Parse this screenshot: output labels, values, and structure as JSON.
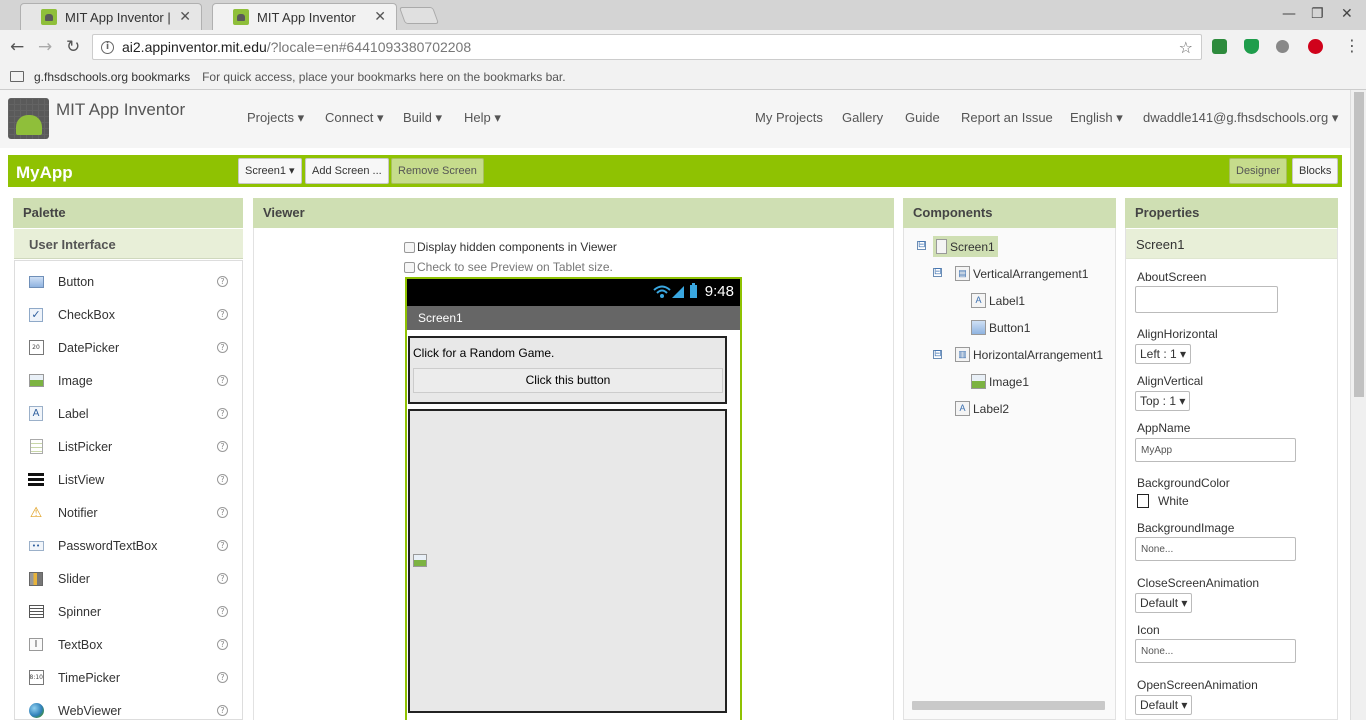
{
  "browser": {
    "tabs": [
      {
        "title": "MIT App Inventor | Explo",
        "active": false
      },
      {
        "title": "MIT App Inventor",
        "active": true
      }
    ],
    "url_host": "ai2.appinventor.mit.edu",
    "url_rest": "/?locale=en#6441093380702208",
    "bookmarks": {
      "folder": "g.fhsdschools.org bookmarks",
      "hint": "For quick access, place your bookmarks here on the bookmarks bar."
    },
    "extensions": [
      "google-drive-icon",
      "shield-icon",
      "audio-icon",
      "adblock-icon"
    ]
  },
  "app": {
    "title": "MIT App Inventor",
    "nav_left": [
      "Projects ▾",
      "Connect ▾",
      "Build ▾",
      "Help ▾"
    ],
    "nav_right": [
      "My Projects",
      "Gallery",
      "Guide",
      "Report an Issue",
      "English ▾",
      "dwaddle141@g.fhsdschools.org ▾"
    ]
  },
  "project": {
    "name": "MyApp",
    "screen_select": "Screen1 ▾",
    "add_screen": "Add Screen ...",
    "remove_screen": "Remove Screen",
    "designer": "Designer",
    "blocks": "Blocks"
  },
  "palette": {
    "header": "Palette",
    "category": "User Interface",
    "items": [
      "Button",
      "CheckBox",
      "DatePicker",
      "Image",
      "Label",
      "ListPicker",
      "ListView",
      "Notifier",
      "PasswordTextBox",
      "Slider",
      "Spinner",
      "TextBox",
      "TimePicker",
      "WebViewer"
    ],
    "help_glyph": "?"
  },
  "viewer": {
    "header": "Viewer",
    "hidden_option": "Display hidden components in Viewer",
    "tablet_option": "Check to see Preview on Tablet size.",
    "time": "9:48",
    "screen_title": "Screen1",
    "label1_text": "Click for a Random Game.",
    "button1_text": "Click this button"
  },
  "components": {
    "header": "Components",
    "tree": [
      {
        "name": "Screen1",
        "icon": "screen-icon",
        "depth": 0,
        "expandable": true,
        "selected": true
      },
      {
        "name": "VerticalArrangement1",
        "icon": "vertical-arrangement-icon",
        "depth": 1,
        "expandable": true
      },
      {
        "name": "Label1",
        "icon": "label-icon",
        "depth": 2
      },
      {
        "name": "Button1",
        "icon": "button-icon",
        "depth": 2
      },
      {
        "name": "HorizontalArrangement1",
        "icon": "horizontal-arrangement-icon",
        "depth": 1,
        "expandable": true
      },
      {
        "name": "Image1",
        "icon": "image-icon",
        "depth": 2
      },
      {
        "name": "Label2",
        "icon": "label-icon",
        "depth": 1
      }
    ],
    "toggle_glyph": "⊟"
  },
  "properties": {
    "header": "Properties",
    "component": "Screen1",
    "fields": {
      "about_label": "AboutScreen",
      "align_h_label": "AlignHorizontal",
      "align_h_value": "Left : 1 ▾",
      "align_v_label": "AlignVertical",
      "align_v_value": "Top : 1 ▾",
      "appname_label": "AppName",
      "appname_value": "MyApp",
      "bgcolor_label": "BackgroundColor",
      "bgcolor_value": "White",
      "bgimage_label": "BackgroundImage",
      "bgimage_value": "None...",
      "close_anim_label": "CloseScreenAnimation",
      "close_anim_value": "Default ▾",
      "icon_label": "Icon",
      "icon_value": "None...",
      "open_anim_label": "OpenScreenAnimation",
      "open_anim_value": "Default ▾"
    }
  },
  "colors": {
    "accent_green": "#8fc202",
    "panel_header": "#cfdfb3",
    "wifi_blue": "#3aa7e0"
  }
}
